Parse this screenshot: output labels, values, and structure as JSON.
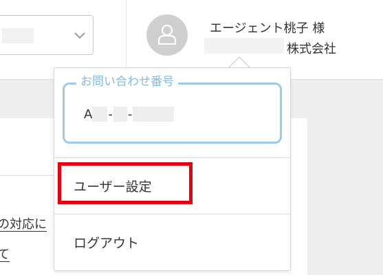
{
  "header": {
    "user_name": "エージェント桃子 様",
    "company_suffix": "株式会社"
  },
  "background": {
    "link_1": "の対応に",
    "link_2": "て"
  },
  "dropdown": {
    "inquiry_label": "お問い合わせ番号",
    "inquiry_prefix": "A",
    "inquiry_sep": "-",
    "menu": [
      {
        "label": "ユーザー設定",
        "highlighted": true
      },
      {
        "label": "ログアウト",
        "highlighted": false
      }
    ]
  },
  "colors": {
    "accent_blue": "#9cc9ee",
    "legend_blue": "#7dbbe9",
    "highlight_red": "#e60012"
  },
  "icons": {
    "avatar": "user-icon",
    "select_chevron": "chevron-down-icon"
  }
}
